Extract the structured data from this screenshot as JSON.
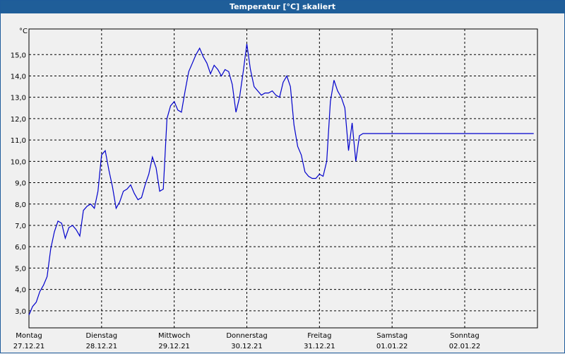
{
  "window": {
    "title": "Temperatur [°C] skaliert"
  },
  "chart_data": {
    "type": "line",
    "title": "Temperatur [°C] skaliert",
    "ylabel": "°C",
    "xlabel": "",
    "ylim": [
      2.2,
      16.2
    ],
    "xlim": [
      0,
      7
    ],
    "grid": true,
    "line_color": "#0000cc",
    "yticks": [
      "3,0",
      "4,0",
      "5,0",
      "6,0",
      "7,0",
      "8,0",
      "9,0",
      "10,0",
      "11,0",
      "12,0",
      "13,0",
      "14,0",
      "15,0"
    ],
    "ytick_values": [
      3,
      4,
      5,
      6,
      7,
      8,
      9,
      10,
      11,
      12,
      13,
      14,
      15
    ],
    "xticks": [
      {
        "day": "Montag",
        "date": "27.12.21"
      },
      {
        "day": "Dienstag",
        "date": "28.12.21"
      },
      {
        "day": "Mittwoch",
        "date": "29.12.21"
      },
      {
        "day": "Donnerstag",
        "date": "30.12.21"
      },
      {
        "day": "Freitag",
        "date": "31.12.21"
      },
      {
        "day": "Samstag",
        "date": "01.01.22"
      },
      {
        "day": "Sonntag",
        "date": "02.01.22"
      }
    ],
    "series": [
      {
        "x": [
          0.0,
          0.05,
          0.1,
          0.15,
          0.2,
          0.25,
          0.3,
          0.35,
          0.4,
          0.45,
          0.5,
          0.55,
          0.6,
          0.65,
          0.7,
          0.75,
          0.8,
          0.85,
          0.9,
          0.95,
          1.0,
          1.05,
          1.1,
          1.15,
          1.2,
          1.25,
          1.3,
          1.35,
          1.4,
          1.45,
          1.5,
          1.55,
          1.6,
          1.65,
          1.7,
          1.75,
          1.8,
          1.85,
          1.9,
          1.95,
          2.0,
          2.05,
          2.1,
          2.15,
          2.2,
          2.25,
          2.3,
          2.35,
          2.4,
          2.45,
          2.5,
          2.55,
          2.6,
          2.65,
          2.7,
          2.75,
          2.8,
          2.85,
          2.9,
          2.95,
          3.0,
          3.05,
          3.1,
          3.15,
          3.2,
          3.25,
          3.3,
          3.35,
          3.4,
          3.45,
          3.5,
          3.55,
          3.6,
          3.65,
          3.7,
          3.75,
          3.8,
          3.85,
          3.9,
          3.95,
          4.0,
          4.05,
          4.1,
          4.15,
          4.2,
          4.25,
          4.3,
          4.35,
          4.4,
          4.45,
          4.5,
          4.55,
          4.6,
          4.65,
          4.7,
          4.75,
          4.8,
          4.85,
          4.9,
          4.95,
          5.0,
          5.05,
          5.1,
          5.15,
          5.2,
          5.25,
          5.3,
          5.35,
          5.4,
          5.45,
          5.5,
          5.55,
          5.6,
          5.65,
          5.7,
          5.75,
          5.8,
          5.85,
          5.9,
          5.95,
          6.0,
          6.05,
          6.1,
          6.15,
          6.2,
          6.25,
          6.3,
          6.35,
          6.4,
          6.45,
          6.5,
          6.55,
          6.6,
          6.65,
          6.7,
          6.75,
          6.8,
          6.85,
          6.9,
          6.95,
          7.0
        ],
        "y": [
          2.8,
          3.2,
          3.4,
          3.9,
          4.2,
          4.6,
          5.9,
          6.7,
          7.2,
          7.1,
          6.4,
          6.9,
          7.0,
          6.8,
          6.5,
          7.7,
          7.9,
          8.0,
          7.8,
          8.6,
          10.3,
          10.5,
          9.6,
          8.8,
          7.8,
          8.1,
          8.6,
          8.7,
          8.9,
          8.5,
          8.2,
          8.3,
          8.9,
          9.4,
          10.2,
          9.7,
          8.6,
          8.7,
          12.0,
          12.6,
          12.8,
          12.4,
          12.3,
          13.3,
          14.2,
          14.6,
          15.0,
          15.3,
          14.9,
          14.6,
          14.1,
          14.5,
          14.3,
          14.0,
          14.3,
          14.2,
          13.6,
          12.3,
          13.0,
          14.2,
          15.5,
          14.3,
          13.5,
          13.3,
          13.1,
          13.2,
          13.2,
          13.3,
          13.1,
          13.0,
          13.7,
          14.0,
          13.5,
          11.7,
          10.7,
          10.3,
          9.5,
          9.3,
          9.2,
          9.2,
          9.4,
          9.3,
          10.0,
          12.8,
          13.8,
          13.3,
          13.0,
          12.5,
          10.5,
          11.8,
          10.0,
          11.2,
          11.3,
          11.3,
          11.3,
          11.3,
          11.3,
          11.3,
          11.3,
          11.3,
          11.3,
          11.3,
          11.3,
          11.3,
          11.3,
          11.3,
          11.3,
          11.3,
          11.3,
          11.3,
          11.3,
          11.3,
          11.3,
          11.3,
          11.3,
          11.3,
          11.3,
          11.3,
          11.3,
          11.3,
          11.3,
          11.3,
          11.3,
          11.3,
          11.3,
          11.3,
          11.3,
          11.3,
          11.3,
          11.3,
          11.3,
          11.3,
          11.3,
          11.3,
          11.3,
          11.3,
          11.3,
          11.3,
          11.3,
          11.3,
          11.3
        ]
      }
    ]
  }
}
